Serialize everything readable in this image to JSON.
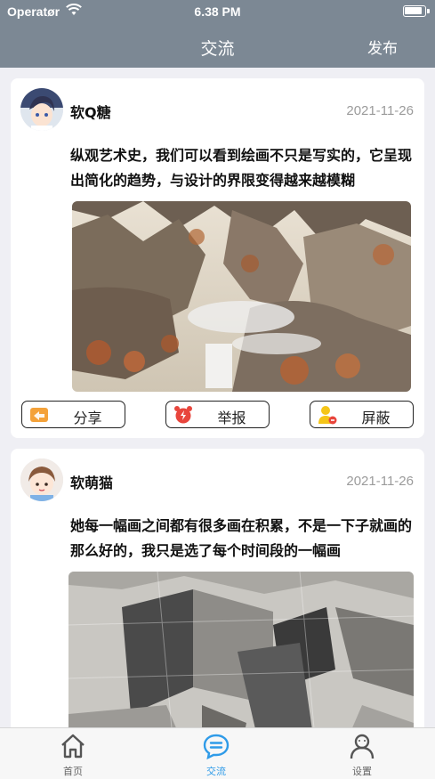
{
  "status_bar": {
    "carrier": "Operatør",
    "time": "6.38 PM"
  },
  "nav": {
    "title": "交流",
    "publish": "发布"
  },
  "posts": [
    {
      "username": "软Q糖",
      "date": "2021-11-26",
      "content": "纵观艺术史，我们可以看到绘画不只是写实的，它呈现出简化的趋势，与设计的界限变得越来越模糊",
      "photo": "landscape-ink-painting",
      "actions": {
        "share": "分享",
        "report": "举报",
        "block": "屏蔽"
      }
    },
    {
      "username": "软萌猫",
      "date": "2021-11-26",
      "content": "她每一幅画之间都有很多画在积累，不是一下子就画的那么好的，我只是选了每个时间段的一幅画",
      "photo": "pencil-sketch"
    }
  ],
  "tabbar": {
    "home": "首页",
    "community": "交流",
    "settings": "设置"
  },
  "colors": {
    "nav_bg": "#7c8894",
    "page_bg": "#efeff4",
    "tab_active": "#2f9be8",
    "share_icon": "#f4a23a",
    "report_icon": "#e8453c",
    "block_icon": "#f5c518"
  }
}
